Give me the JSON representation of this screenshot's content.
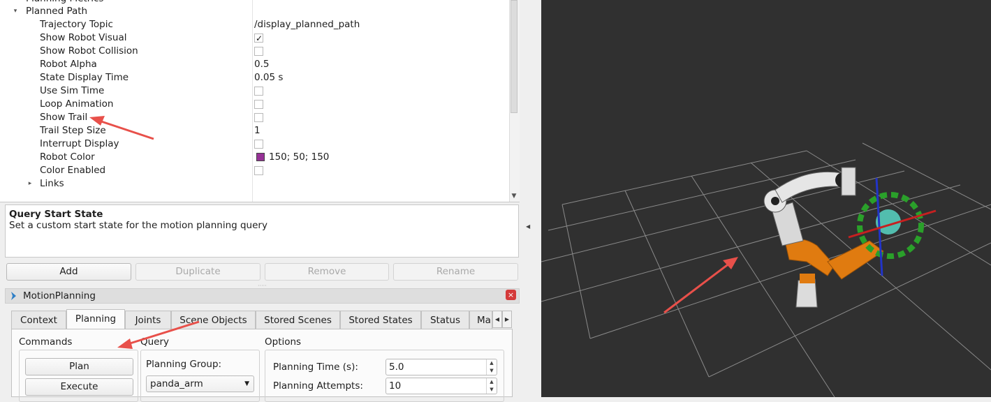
{
  "tree": {
    "partial_top_label": "Planning Metrics",
    "group_label": "Planned Path",
    "rows": [
      {
        "name": "Trajectory Topic",
        "value": "/display_planned_path"
      },
      {
        "name": "Show Robot Visual",
        "checked": true
      },
      {
        "name": "Show Robot Collision",
        "checked": false
      },
      {
        "name": "Robot Alpha",
        "value": "0.5"
      },
      {
        "name": "State Display Time",
        "value": "0.05 s"
      },
      {
        "name": "Use Sim Time",
        "checked": false
      },
      {
        "name": "Loop Animation",
        "checked": false
      },
      {
        "name": "Show Trail",
        "checked": false
      },
      {
        "name": "Trail Step Size",
        "value": "1"
      },
      {
        "name": "Interrupt Display",
        "checked": false
      },
      {
        "name": "Robot Color",
        "value": "150; 50; 150",
        "color": "#963296"
      },
      {
        "name": "Color Enabled",
        "checked": false
      },
      {
        "name": "Links"
      }
    ]
  },
  "description": {
    "title": "Query Start State",
    "text": "Set a custom start state for the motion planning query"
  },
  "buttons": {
    "add": "Add",
    "duplicate": "Duplicate",
    "remove": "Remove",
    "rename": "Rename"
  },
  "panel": {
    "title": "MotionPlanning",
    "tabs": [
      "Context",
      "Planning",
      "Joints",
      "Scene Objects",
      "Stored Scenes",
      "Stored States",
      "Status",
      "Ma"
    ],
    "selected_tab": "Planning",
    "commands": {
      "title": "Commands",
      "plan": "Plan",
      "execute": "Execute"
    },
    "query": {
      "title": "Query",
      "planning_group_label": "Planning Group:",
      "planning_group_value": "panda_arm"
    },
    "options": {
      "title": "Options",
      "planning_time_label": "Planning Time (s):",
      "planning_time_value": "5.0",
      "planning_attempts_label": "Planning Attempts:",
      "planning_attempts_value": "10"
    }
  },
  "colors": {
    "annotation_arrow": "#e8504a",
    "robot_orange": "#e07b10",
    "viewport_bg": "#303030",
    "grid": "#8a8a8a"
  }
}
